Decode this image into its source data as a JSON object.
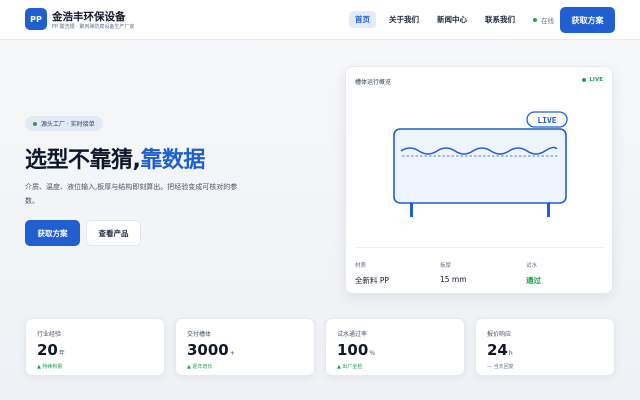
{
  "header": {
    "logo_text": "PP",
    "brand_name": "金浩丰环保设备",
    "brand_sub": "PP 酸洗槽 · 聚丙烯防腐设备生产厂家",
    "nav": [
      {
        "label": "首页",
        "active": true
      },
      {
        "label": "关于我们",
        "active": false
      },
      {
        "label": "新闻中心",
        "active": false
      },
      {
        "label": "联系我们",
        "active": false
      }
    ],
    "online_label": "在线",
    "cta_label": "获取方案"
  },
  "hero": {
    "badge": "源头工厂 · 实时接单",
    "headline_part1": "选型不靠猜,",
    "headline_part2": "靠数据",
    "description": "介质、温度、液位输入,板厚与结构即刻算出。把经验变成可核对的参数。",
    "primary_cta": "获取方案",
    "secondary_cta": "查看产品"
  },
  "tank_card": {
    "title": "槽体运行概览",
    "live_status": "LIVE",
    "live_badge": "LIVE",
    "specs": [
      {
        "label": "材质",
        "value": "全新料 PP"
      },
      {
        "label": "板厚",
        "value": "15 mm"
      },
      {
        "label": "试水",
        "value": "通过"
      }
    ]
  },
  "stats": [
    {
      "label": "行业经验",
      "value": "20",
      "unit": "年",
      "note": "▲ 持续积累"
    },
    {
      "label": "交付槽体",
      "value": "3000",
      "unit": "+",
      "note": "▲ 逐年增长"
    },
    {
      "label": "试水通过率",
      "value": "100",
      "unit": "%",
      "note": "▲ 出厂全检"
    },
    {
      "label": "报价响应",
      "value": "24",
      "unit": "h",
      "note": "— 当天回复"
    }
  ],
  "colors": {
    "accent": "#1f5fd0",
    "success": "#16a34a",
    "nav_active_bg": "#e3ebf7"
  }
}
